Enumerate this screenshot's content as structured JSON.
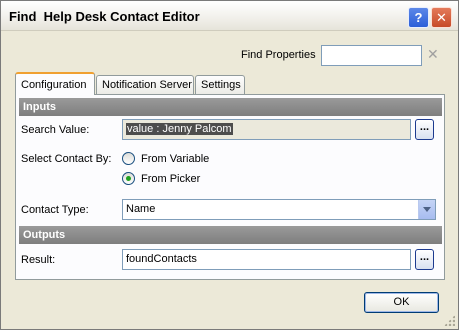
{
  "window": {
    "title": "Find  Help Desk Contact Editor",
    "help_glyph": "?",
    "close_glyph": "✕"
  },
  "find_properties": {
    "label": "Find Properties",
    "value": "",
    "clear_glyph": "✕"
  },
  "tabs": [
    {
      "label": "Configuration",
      "active": true
    },
    {
      "label": "Notification Server",
      "active": false
    },
    {
      "label": "Settings",
      "active": false
    }
  ],
  "inputs": {
    "section_label": "Inputs",
    "search_value": {
      "label": "Search Value:",
      "value": "value : Jenny Palcom",
      "browse_label": "..."
    },
    "select_contact_by": {
      "label": "Select Contact By:",
      "options": [
        {
          "label": "From Variable",
          "checked": false
        },
        {
          "label": "From Picker",
          "checked": true
        }
      ]
    },
    "contact_type": {
      "label": "Contact Type:",
      "selected": "Name"
    }
  },
  "outputs": {
    "section_label": "Outputs",
    "result": {
      "label": "Result:",
      "value": "foundContacts",
      "browse_label": "..."
    }
  },
  "footer": {
    "ok_label": "OK"
  },
  "colors": {
    "dialog_bg": "#ece9d8",
    "section_header_bg": "#8c8c8c",
    "active_tab_accent": "#f0a030",
    "radio_checked": "#21a121"
  }
}
